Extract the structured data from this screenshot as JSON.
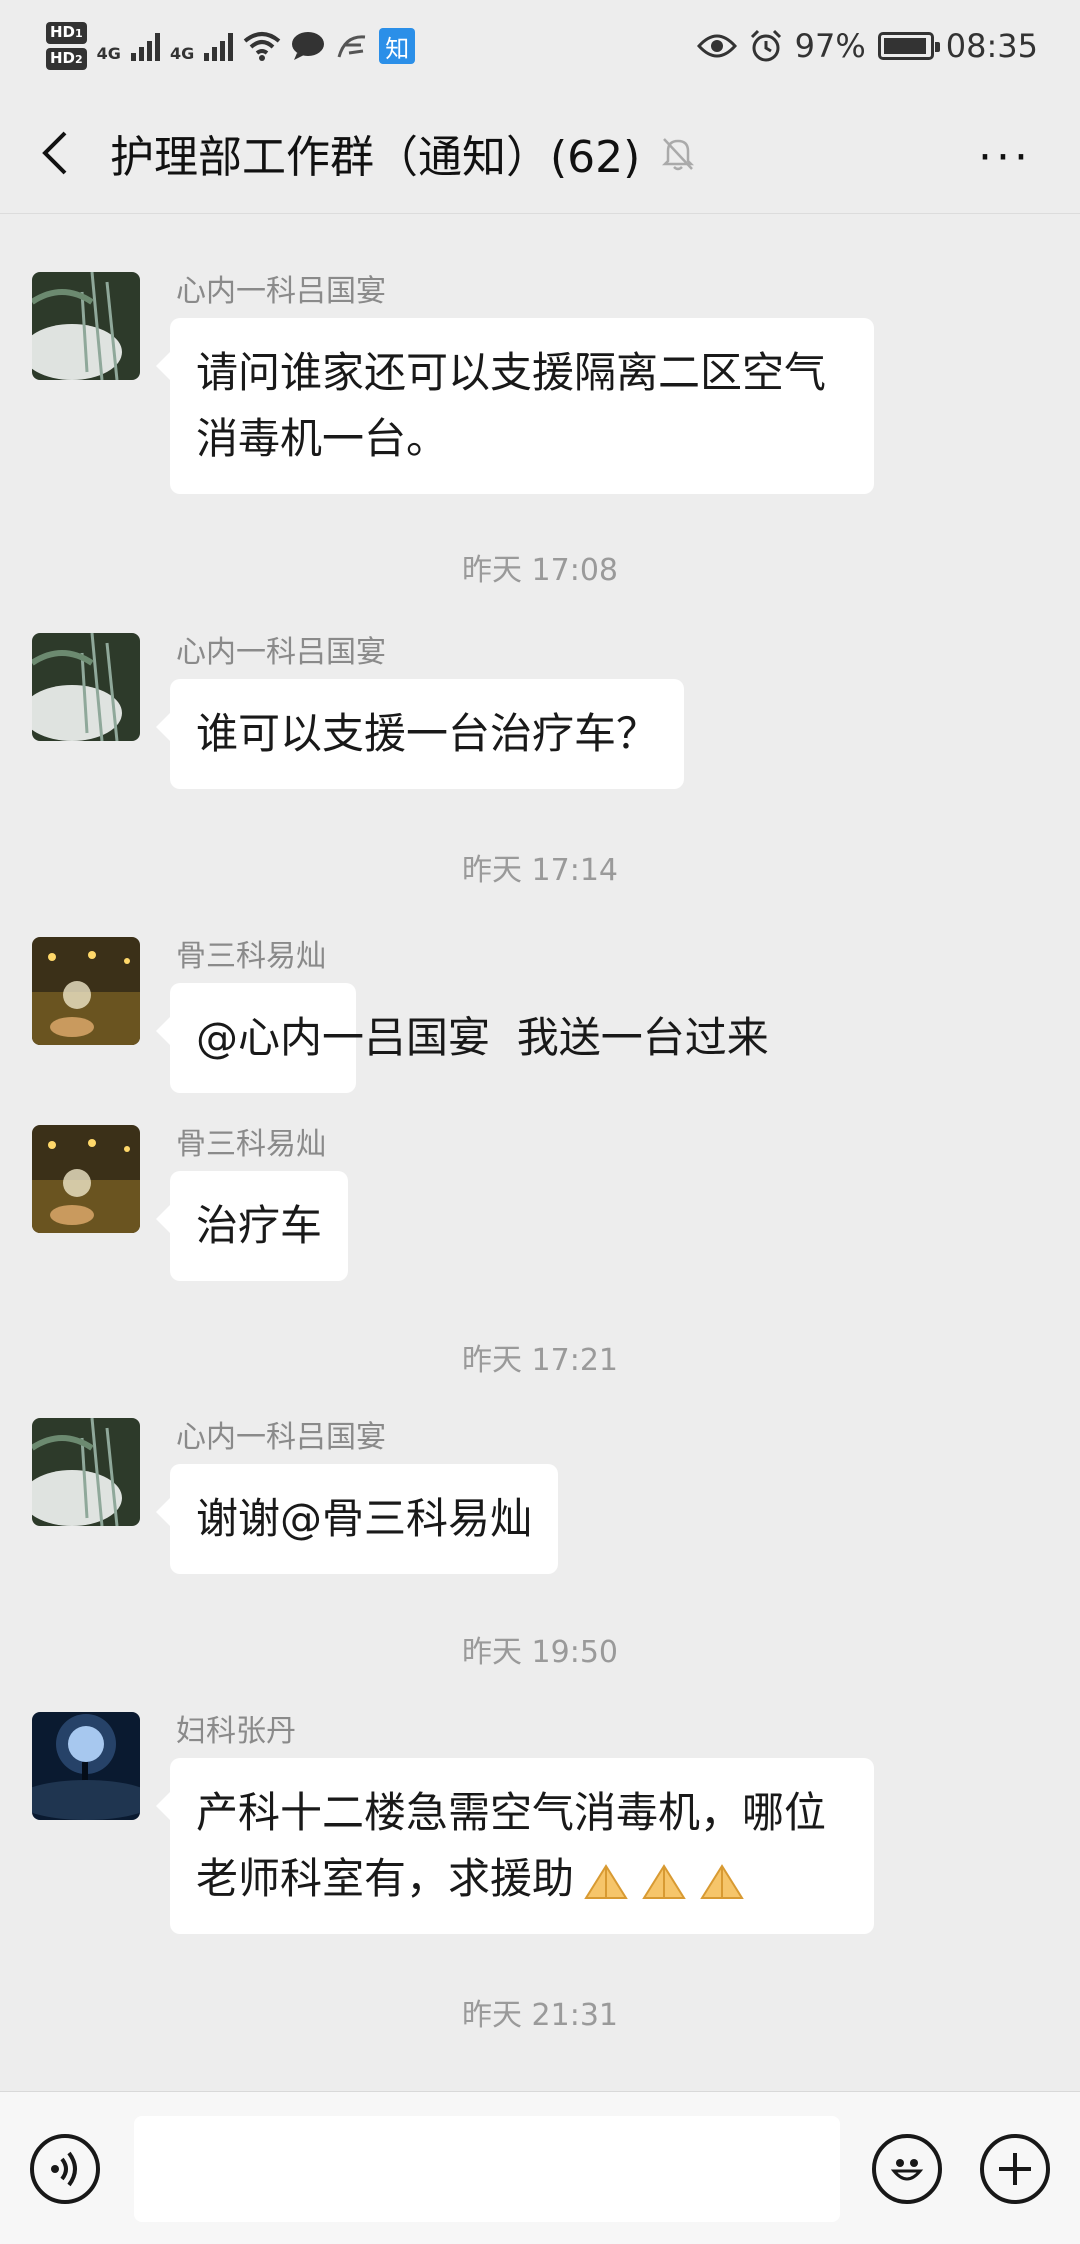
{
  "status_bar": {
    "hd1": "HD",
    "hd1_num": "1",
    "hd2": "HD",
    "hd2_num": "2",
    "net1": "4G",
    "net2": "4G",
    "zhi_badge": "知",
    "battery_pct": "97%",
    "battery_level": 0.97,
    "time": "08:35",
    "icons": [
      "hd-icon",
      "signal-icon",
      "wifi-icon",
      "chat-bubble-icon",
      "app-icon",
      "zhihu-icon",
      "eye-icon",
      "alarm-icon",
      "battery-icon"
    ]
  },
  "header": {
    "title": "护理部工作群（通知）(62)",
    "more": "···",
    "icons": [
      "back-chevron-icon",
      "bell-muted-icon",
      "more-icon"
    ]
  },
  "messages": [
    {
      "type": "msg",
      "sender": "心内一科吕国宴",
      "text": "请问谁家还可以支援隔离二区空气消毒机一台。",
      "lines": [
        "请问谁家还可以支援隔离二区空气",
        "消毒机一台。"
      ],
      "avatar": "night-tree"
    },
    {
      "type": "time",
      "text": "昨天 17:08"
    },
    {
      "type": "msg",
      "sender": "心内一科吕国宴",
      "text": "谁可以支援一台治疗车？",
      "lines": [
        "谁可以支援一台治疗车？"
      ],
      "avatar": "night-tree"
    },
    {
      "type": "time",
      "text": "昨天 17:14"
    },
    {
      "type": "msg",
      "sender": "骨三科易灿",
      "text": "@心内一吕国宴  我送一台过来",
      "lines": [
        "@心内一吕国宴  我送一台过来"
      ],
      "avatar": "street-dandelion"
    },
    {
      "type": "msg",
      "sender": "骨三科易灿",
      "text": "治疗车",
      "lines": [
        "治疗车"
      ],
      "avatar": "street-dandelion"
    },
    {
      "type": "time",
      "text": "昨天 17:21"
    },
    {
      "type": "msg",
      "sender": "心内一科吕国宴",
      "text": "谢谢@骨三科易灿",
      "lines": [
        "谢谢@骨三科易灿"
      ],
      "avatar": "night-tree"
    },
    {
      "type": "time",
      "text": "昨天 19:50"
    },
    {
      "type": "msg",
      "sender": "妇科张丹",
      "text": "产科十二楼急需空气消毒机，哪位老师科室有，求援助",
      "lines": [
        "产科十二楼急需空气消毒机，哪位",
        "老师科室有，求援助"
      ],
      "emoji": [
        "pray-emoji",
        "pray-emoji",
        "pray-emoji"
      ],
      "avatar": "blue-moon"
    },
    {
      "type": "time",
      "text": "昨天 21:31"
    }
  ],
  "input_bar": {
    "placeholder": "",
    "icons": [
      "voice-icon",
      "emoji-icon",
      "plus-icon"
    ]
  },
  "colors": {
    "background": "#ededed",
    "bubble": "#ffffff",
    "time_text": "#9a9a9a",
    "sender_text": "#8a8a8a"
  }
}
